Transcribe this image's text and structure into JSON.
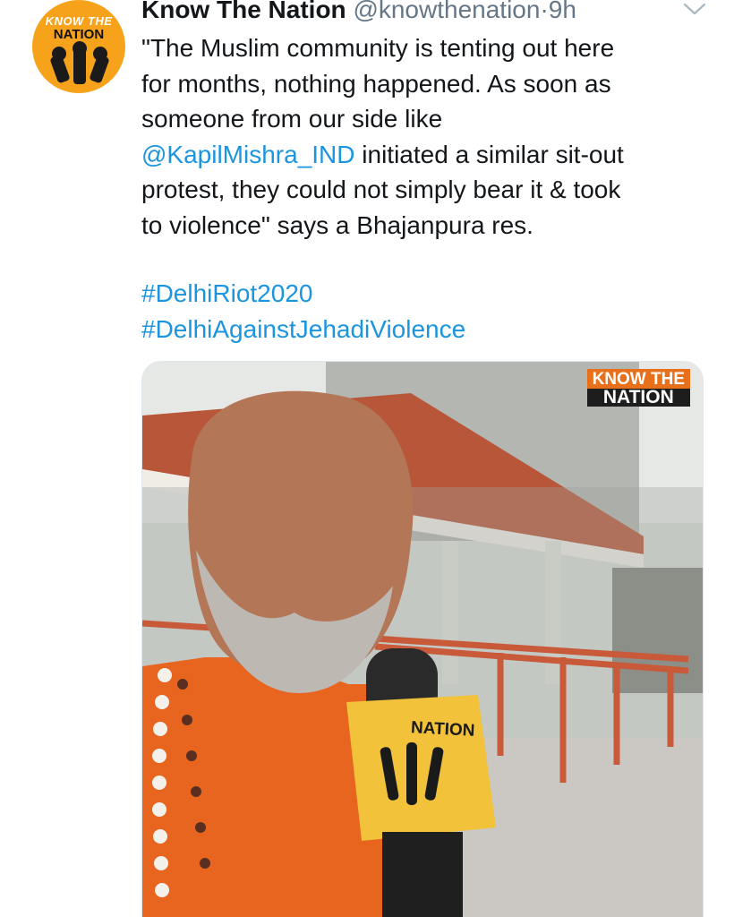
{
  "tweet": {
    "avatar": {
      "logo_line1": "KNOW THE",
      "logo_line2": "NATION"
    },
    "display_name": "Know The Nation",
    "handle": "@knowthenation",
    "separator": "·",
    "time": "9h",
    "body_line1": "\"The Muslim community is tenting out here",
    "body_line2": "for months, nothing happened. As soon as",
    "body_line3": "someone from our side like",
    "mention": "@KapilMishra_IND",
    "body_line4_rest": " initiated a similar sit-out",
    "body_line5": "protest, they could not simply bear it & took",
    "body_line6": "to violence\" says a Bhajanpura res.",
    "hashtags": [
      "#DelhiRiot2020",
      "#DelhiAgainstJehadiViolence"
    ]
  },
  "media": {
    "watermark_line1": "KNOW THE",
    "watermark_line2": "NATION",
    "mic_label": "NATION"
  },
  "colors": {
    "link": "#1b95e0",
    "muted": "#657786",
    "brand_orange": "#f7a21b"
  },
  "icons": [
    "chevron-down-icon",
    "fist-icon"
  ]
}
